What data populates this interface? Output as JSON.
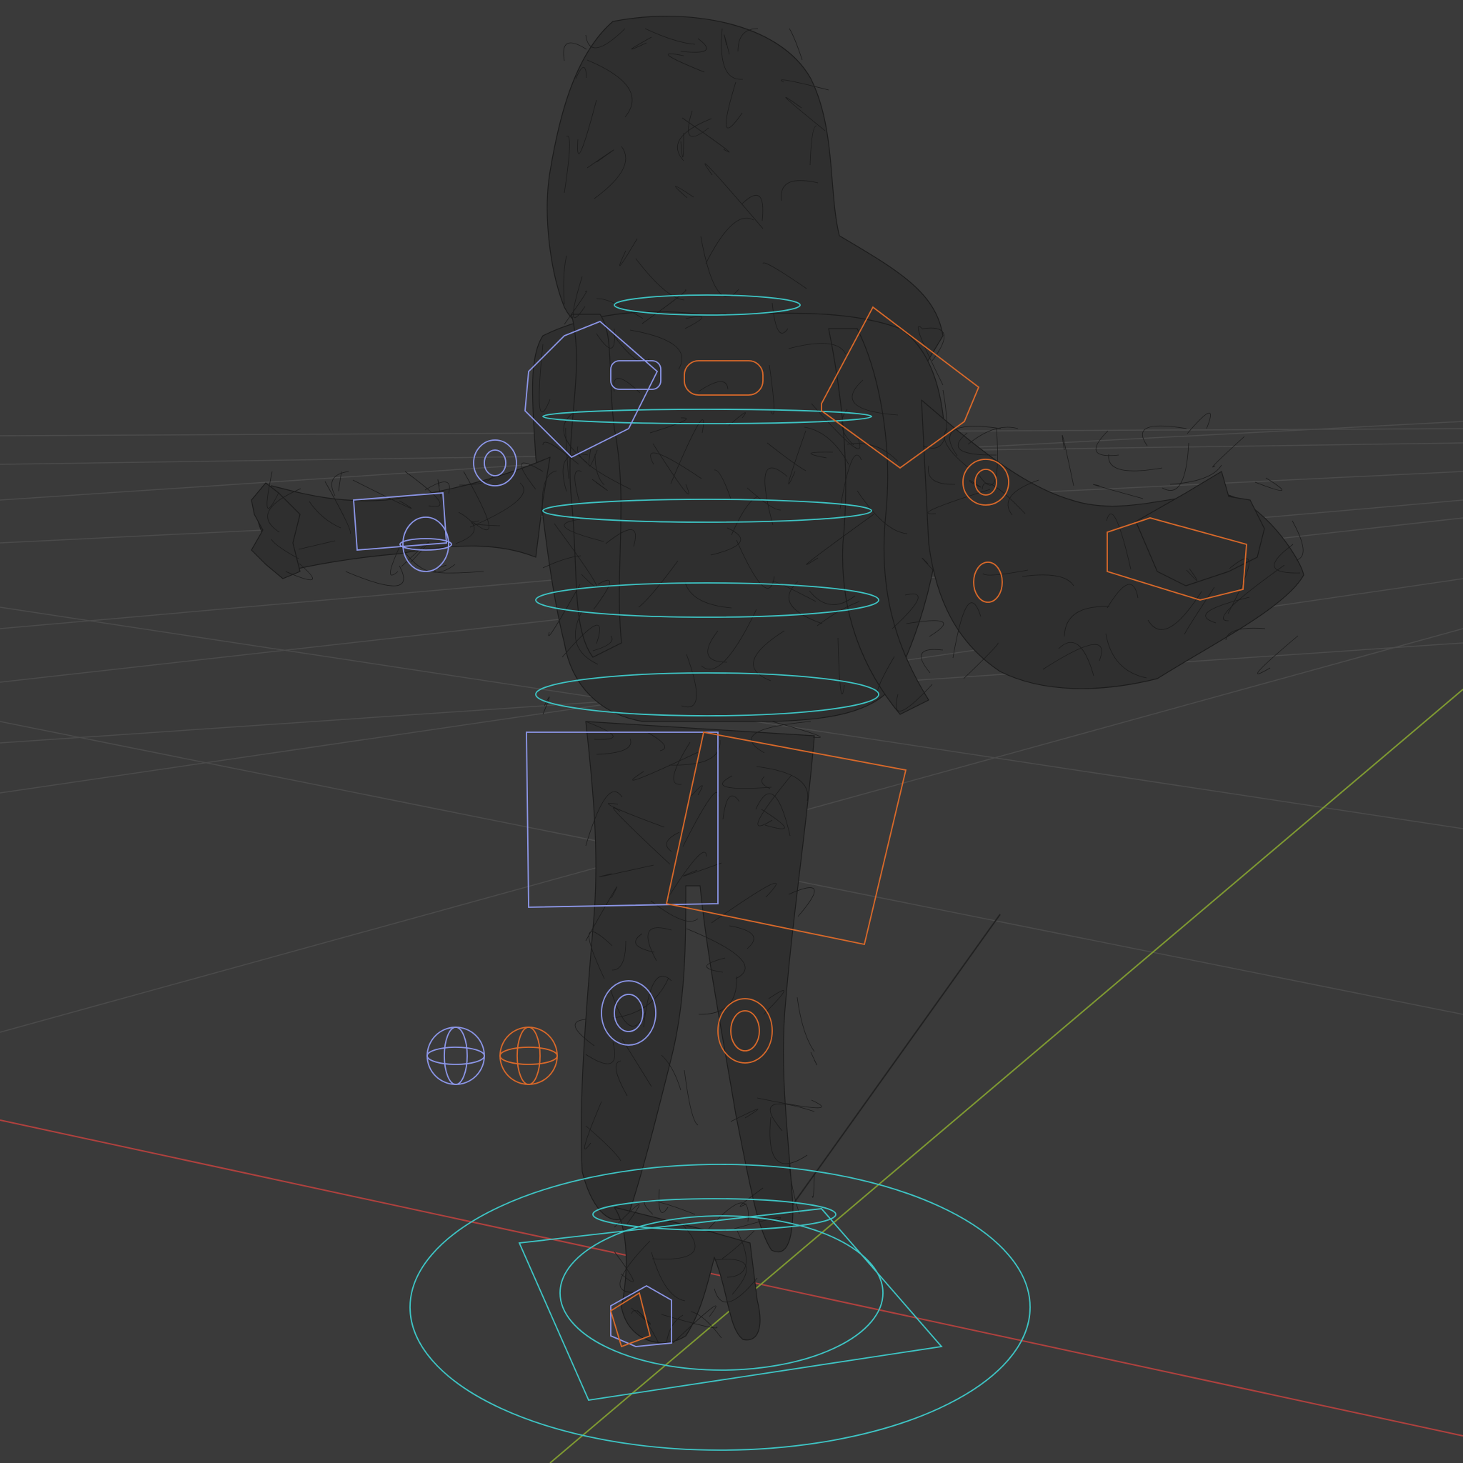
{
  "viewport": {
    "view": "3d-viewport",
    "shading": "wireframe",
    "background_color": "#3a3a3a",
    "grid_color": "#4b4b4b",
    "axis_x_color": "#b0413e",
    "axis_y_color": "#7f9a32",
    "axis_z_color": "#222222",
    "mesh_line_color": "#1c1c1c",
    "mesh_fill_color": "#2f2f2f"
  },
  "rig": {
    "center_control_color": "#3ec5c5",
    "left_control_color": "#8c96e8",
    "right_control_color": "#d9692a",
    "objects": [
      "character-mesh",
      "root-control",
      "spine-controls",
      "shoulder-controls",
      "arm-controls",
      "hand-controls",
      "leg-controls",
      "knee-pole-targets",
      "foot-controls"
    ]
  }
}
